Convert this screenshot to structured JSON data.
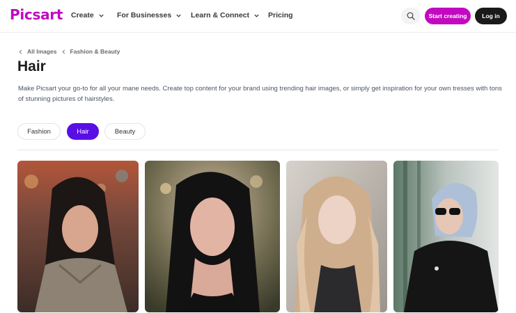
{
  "header": {
    "logo": "Picsart",
    "nav": [
      {
        "label": "Create",
        "has_menu": true
      },
      {
        "label": "For Businesses",
        "has_menu": true
      },
      {
        "label": "Learn & Connect",
        "has_menu": true
      },
      {
        "label": "Pricing",
        "has_menu": false
      }
    ],
    "start_label": "Start creating",
    "login_label": "Log in",
    "search_icon": "search-icon"
  },
  "breadcrumb": [
    {
      "label": "All Images"
    },
    {
      "label": "Fashion & Beauty"
    }
  ],
  "page": {
    "title": "Hair",
    "description": "Make Picsart your go-to for all your mane needs. Create top content for your brand using trending hair images, or simply get inspiration for your own tresses with tons of stunning pictures of hairstyles."
  },
  "tabs": [
    {
      "label": "Fashion",
      "active": false
    },
    {
      "label": "Hair",
      "active": true
    },
    {
      "label": "Beauty",
      "active": false
    }
  ],
  "colors": {
    "brand": "#c209c1",
    "active_tab": "#5a0ee6",
    "login": "#1a1a1a"
  },
  "gallery": [
    {
      "subject": "woman-with-long-dark-hair-in-shirt"
    },
    {
      "subject": "woman-with-sleek-black-hair"
    },
    {
      "subject": "woman-with-wavy-blonde-hair"
    },
    {
      "subject": "woman-with-silver-bob-and-sunglasses"
    }
  ]
}
